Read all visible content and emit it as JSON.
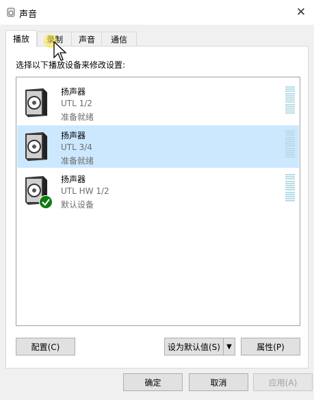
{
  "window": {
    "title": "声音"
  },
  "tabs": [
    {
      "label": "播放"
    },
    {
      "label": "录制"
    },
    {
      "label": "声音"
    },
    {
      "label": "通信"
    }
  ],
  "instruction": "选择以下播放设备来修改设置:",
  "devices": [
    {
      "name": "扬声器",
      "sub": "UTL 1/2",
      "status": "准备就绪",
      "selected": false,
      "default": false
    },
    {
      "name": "扬声器",
      "sub": "UTL 3/4",
      "status": "准备就绪",
      "selected": true,
      "default": false
    },
    {
      "name": "扬声器",
      "sub": "UTL HW 1/2",
      "status": "默认设备",
      "selected": false,
      "default": true
    }
  ],
  "buttons": {
    "configure": "配置(C)",
    "set_default": "设为默认值(S)",
    "properties": "属性(P)",
    "ok": "确定",
    "cancel": "取消",
    "apply": "应用(A)"
  },
  "icons": {
    "speaker": "speaker-icon",
    "default_check": "check-icon",
    "close": "close-icon",
    "split_arrow": "chevron-down-icon"
  },
  "colors": {
    "selected_row": "#cce8ff",
    "check_green": "#107c10",
    "meter": "#b8dce6"
  }
}
